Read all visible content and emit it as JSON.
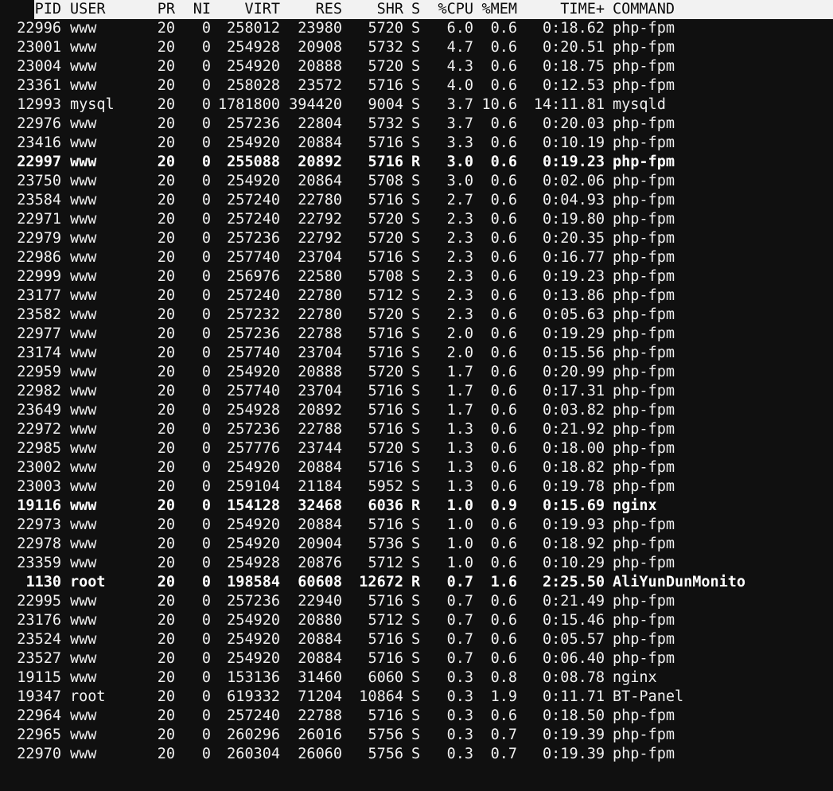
{
  "headers": {
    "pid": "PID",
    "user": "USER",
    "pr": "PR",
    "ni": "NI",
    "virt": "VIRT",
    "res": "RES",
    "shr": "SHR",
    "s": "S",
    "cpu": "%CPU",
    "mem": "%MEM",
    "time": "TIME+",
    "command": "COMMAND"
  },
  "processes": [
    {
      "pid": "22996",
      "user": "www",
      "pr": "20",
      "ni": "0",
      "virt": "258012",
      "res": "23980",
      "shr": "5720",
      "s": "S",
      "cpu": "6.0",
      "mem": "0.6",
      "time": "0:18.62",
      "command": "php-fpm",
      "bold": false
    },
    {
      "pid": "23001",
      "user": "www",
      "pr": "20",
      "ni": "0",
      "virt": "254928",
      "res": "20908",
      "shr": "5732",
      "s": "S",
      "cpu": "4.7",
      "mem": "0.6",
      "time": "0:20.51",
      "command": "php-fpm",
      "bold": false
    },
    {
      "pid": "23004",
      "user": "www",
      "pr": "20",
      "ni": "0",
      "virt": "254920",
      "res": "20888",
      "shr": "5720",
      "s": "S",
      "cpu": "4.3",
      "mem": "0.6",
      "time": "0:18.75",
      "command": "php-fpm",
      "bold": false
    },
    {
      "pid": "23361",
      "user": "www",
      "pr": "20",
      "ni": "0",
      "virt": "258028",
      "res": "23572",
      "shr": "5716",
      "s": "S",
      "cpu": "4.0",
      "mem": "0.6",
      "time": "0:12.53",
      "command": "php-fpm",
      "bold": false
    },
    {
      "pid": "12993",
      "user": "mysql",
      "pr": "20",
      "ni": "0",
      "virt": "1781800",
      "res": "394420",
      "shr": "9004",
      "s": "S",
      "cpu": "3.7",
      "mem": "10.6",
      "time": "14:11.81",
      "command": "mysqld",
      "bold": false
    },
    {
      "pid": "22976",
      "user": "www",
      "pr": "20",
      "ni": "0",
      "virt": "257236",
      "res": "22804",
      "shr": "5732",
      "s": "S",
      "cpu": "3.7",
      "mem": "0.6",
      "time": "0:20.03",
      "command": "php-fpm",
      "bold": false
    },
    {
      "pid": "23416",
      "user": "www",
      "pr": "20",
      "ni": "0",
      "virt": "254920",
      "res": "20884",
      "shr": "5716",
      "s": "S",
      "cpu": "3.3",
      "mem": "0.6",
      "time": "0:10.19",
      "command": "php-fpm",
      "bold": false
    },
    {
      "pid": "22997",
      "user": "www",
      "pr": "20",
      "ni": "0",
      "virt": "255088",
      "res": "20892",
      "shr": "5716",
      "s": "R",
      "cpu": "3.0",
      "mem": "0.6",
      "time": "0:19.23",
      "command": "php-fpm",
      "bold": true
    },
    {
      "pid": "23750",
      "user": "www",
      "pr": "20",
      "ni": "0",
      "virt": "254920",
      "res": "20864",
      "shr": "5708",
      "s": "S",
      "cpu": "3.0",
      "mem": "0.6",
      "time": "0:02.06",
      "command": "php-fpm",
      "bold": false
    },
    {
      "pid": "23584",
      "user": "www",
      "pr": "20",
      "ni": "0",
      "virt": "257240",
      "res": "22780",
      "shr": "5716",
      "s": "S",
      "cpu": "2.7",
      "mem": "0.6",
      "time": "0:04.93",
      "command": "php-fpm",
      "bold": false
    },
    {
      "pid": "22971",
      "user": "www",
      "pr": "20",
      "ni": "0",
      "virt": "257240",
      "res": "22792",
      "shr": "5720",
      "s": "S",
      "cpu": "2.3",
      "mem": "0.6",
      "time": "0:19.80",
      "command": "php-fpm",
      "bold": false
    },
    {
      "pid": "22979",
      "user": "www",
      "pr": "20",
      "ni": "0",
      "virt": "257236",
      "res": "22792",
      "shr": "5720",
      "s": "S",
      "cpu": "2.3",
      "mem": "0.6",
      "time": "0:20.35",
      "command": "php-fpm",
      "bold": false
    },
    {
      "pid": "22986",
      "user": "www",
      "pr": "20",
      "ni": "0",
      "virt": "257740",
      "res": "23704",
      "shr": "5716",
      "s": "S",
      "cpu": "2.3",
      "mem": "0.6",
      "time": "0:16.77",
      "command": "php-fpm",
      "bold": false
    },
    {
      "pid": "22999",
      "user": "www",
      "pr": "20",
      "ni": "0",
      "virt": "256976",
      "res": "22580",
      "shr": "5708",
      "s": "S",
      "cpu": "2.3",
      "mem": "0.6",
      "time": "0:19.23",
      "command": "php-fpm",
      "bold": false
    },
    {
      "pid": "23177",
      "user": "www",
      "pr": "20",
      "ni": "0",
      "virt": "257240",
      "res": "22780",
      "shr": "5712",
      "s": "S",
      "cpu": "2.3",
      "mem": "0.6",
      "time": "0:13.86",
      "command": "php-fpm",
      "bold": false
    },
    {
      "pid": "23582",
      "user": "www",
      "pr": "20",
      "ni": "0",
      "virt": "257232",
      "res": "22780",
      "shr": "5720",
      "s": "S",
      "cpu": "2.3",
      "mem": "0.6",
      "time": "0:05.63",
      "command": "php-fpm",
      "bold": false
    },
    {
      "pid": "22977",
      "user": "www",
      "pr": "20",
      "ni": "0",
      "virt": "257236",
      "res": "22788",
      "shr": "5716",
      "s": "S",
      "cpu": "2.0",
      "mem": "0.6",
      "time": "0:19.29",
      "command": "php-fpm",
      "bold": false
    },
    {
      "pid": "23174",
      "user": "www",
      "pr": "20",
      "ni": "0",
      "virt": "257740",
      "res": "23704",
      "shr": "5716",
      "s": "S",
      "cpu": "2.0",
      "mem": "0.6",
      "time": "0:15.56",
      "command": "php-fpm",
      "bold": false
    },
    {
      "pid": "22959",
      "user": "www",
      "pr": "20",
      "ni": "0",
      "virt": "254920",
      "res": "20888",
      "shr": "5720",
      "s": "S",
      "cpu": "1.7",
      "mem": "0.6",
      "time": "0:20.99",
      "command": "php-fpm",
      "bold": false
    },
    {
      "pid": "22982",
      "user": "www",
      "pr": "20",
      "ni": "0",
      "virt": "257740",
      "res": "23704",
      "shr": "5716",
      "s": "S",
      "cpu": "1.7",
      "mem": "0.6",
      "time": "0:17.31",
      "command": "php-fpm",
      "bold": false
    },
    {
      "pid": "23649",
      "user": "www",
      "pr": "20",
      "ni": "0",
      "virt": "254928",
      "res": "20892",
      "shr": "5716",
      "s": "S",
      "cpu": "1.7",
      "mem": "0.6",
      "time": "0:03.82",
      "command": "php-fpm",
      "bold": false
    },
    {
      "pid": "22972",
      "user": "www",
      "pr": "20",
      "ni": "0",
      "virt": "257236",
      "res": "22788",
      "shr": "5716",
      "s": "S",
      "cpu": "1.3",
      "mem": "0.6",
      "time": "0:21.92",
      "command": "php-fpm",
      "bold": false
    },
    {
      "pid": "22985",
      "user": "www",
      "pr": "20",
      "ni": "0",
      "virt": "257776",
      "res": "23744",
      "shr": "5720",
      "s": "S",
      "cpu": "1.3",
      "mem": "0.6",
      "time": "0:18.00",
      "command": "php-fpm",
      "bold": false
    },
    {
      "pid": "23002",
      "user": "www",
      "pr": "20",
      "ni": "0",
      "virt": "254920",
      "res": "20884",
      "shr": "5716",
      "s": "S",
      "cpu": "1.3",
      "mem": "0.6",
      "time": "0:18.82",
      "command": "php-fpm",
      "bold": false
    },
    {
      "pid": "23003",
      "user": "www",
      "pr": "20",
      "ni": "0",
      "virt": "259104",
      "res": "21184",
      "shr": "5952",
      "s": "S",
      "cpu": "1.3",
      "mem": "0.6",
      "time": "0:19.78",
      "command": "php-fpm",
      "bold": false
    },
    {
      "pid": "19116",
      "user": "www",
      "pr": "20",
      "ni": "0",
      "virt": "154128",
      "res": "32468",
      "shr": "6036",
      "s": "R",
      "cpu": "1.0",
      "mem": "0.9",
      "time": "0:15.69",
      "command": "nginx",
      "bold": true
    },
    {
      "pid": "22973",
      "user": "www",
      "pr": "20",
      "ni": "0",
      "virt": "254920",
      "res": "20884",
      "shr": "5716",
      "s": "S",
      "cpu": "1.0",
      "mem": "0.6",
      "time": "0:19.93",
      "command": "php-fpm",
      "bold": false
    },
    {
      "pid": "22978",
      "user": "www",
      "pr": "20",
      "ni": "0",
      "virt": "254920",
      "res": "20904",
      "shr": "5736",
      "s": "S",
      "cpu": "1.0",
      "mem": "0.6",
      "time": "0:18.92",
      "command": "php-fpm",
      "bold": false
    },
    {
      "pid": "23359",
      "user": "www",
      "pr": "20",
      "ni": "0",
      "virt": "254928",
      "res": "20876",
      "shr": "5712",
      "s": "S",
      "cpu": "1.0",
      "mem": "0.6",
      "time": "0:10.29",
      "command": "php-fpm",
      "bold": false
    },
    {
      "pid": "1130",
      "user": "root",
      "pr": "20",
      "ni": "0",
      "virt": "198584",
      "res": "60608",
      "shr": "12672",
      "s": "R",
      "cpu": "0.7",
      "mem": "1.6",
      "time": "2:25.50",
      "command": "AliYunDunMonito",
      "bold": true
    },
    {
      "pid": "22995",
      "user": "www",
      "pr": "20",
      "ni": "0",
      "virt": "257236",
      "res": "22940",
      "shr": "5716",
      "s": "S",
      "cpu": "0.7",
      "mem": "0.6",
      "time": "0:21.49",
      "command": "php-fpm",
      "bold": false
    },
    {
      "pid": "23176",
      "user": "www",
      "pr": "20",
      "ni": "0",
      "virt": "254920",
      "res": "20880",
      "shr": "5712",
      "s": "S",
      "cpu": "0.7",
      "mem": "0.6",
      "time": "0:15.46",
      "command": "php-fpm",
      "bold": false
    },
    {
      "pid": "23524",
      "user": "www",
      "pr": "20",
      "ni": "0",
      "virt": "254920",
      "res": "20884",
      "shr": "5716",
      "s": "S",
      "cpu": "0.7",
      "mem": "0.6",
      "time": "0:05.57",
      "command": "php-fpm",
      "bold": false
    },
    {
      "pid": "23527",
      "user": "www",
      "pr": "20",
      "ni": "0",
      "virt": "254920",
      "res": "20884",
      "shr": "5716",
      "s": "S",
      "cpu": "0.7",
      "mem": "0.6",
      "time": "0:06.40",
      "command": "php-fpm",
      "bold": false
    },
    {
      "pid": "19115",
      "user": "www",
      "pr": "20",
      "ni": "0",
      "virt": "153136",
      "res": "31460",
      "shr": "6060",
      "s": "S",
      "cpu": "0.3",
      "mem": "0.8",
      "time": "0:08.78",
      "command": "nginx",
      "bold": false
    },
    {
      "pid": "19347",
      "user": "root",
      "pr": "20",
      "ni": "0",
      "virt": "619332",
      "res": "71204",
      "shr": "10864",
      "s": "S",
      "cpu": "0.3",
      "mem": "1.9",
      "time": "0:11.71",
      "command": "BT-Panel",
      "bold": false
    },
    {
      "pid": "22964",
      "user": "www",
      "pr": "20",
      "ni": "0",
      "virt": "257240",
      "res": "22788",
      "shr": "5716",
      "s": "S",
      "cpu": "0.3",
      "mem": "0.6",
      "time": "0:18.50",
      "command": "php-fpm",
      "bold": false
    },
    {
      "pid": "22965",
      "user": "www",
      "pr": "20",
      "ni": "0",
      "virt": "260296",
      "res": "26016",
      "shr": "5756",
      "s": "S",
      "cpu": "0.3",
      "mem": "0.7",
      "time": "0:19.39",
      "command": "php-fpm",
      "bold": false
    },
    {
      "pid": "22970",
      "user": "www",
      "pr": "20",
      "ni": "0",
      "virt": "260304",
      "res": "26060",
      "shr": "5756",
      "s": "S",
      "cpu": "0.3",
      "mem": "0.7",
      "time": "0:19.39",
      "command": "php-fpm",
      "bold": false
    }
  ]
}
